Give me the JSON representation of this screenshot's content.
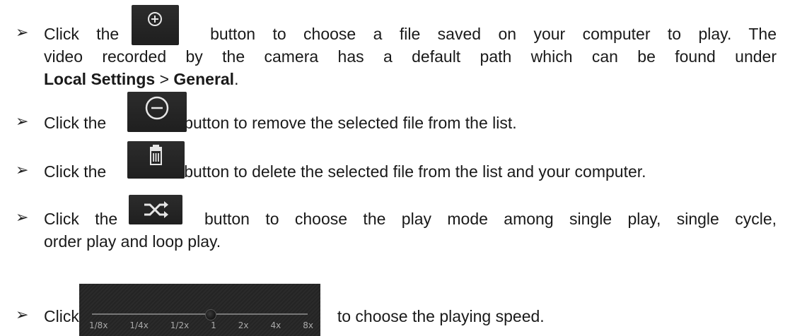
{
  "bullet": "➢",
  "items": [
    {
      "before": "Click the",
      "after": "button to choose a file saved on your computer to play. The",
      "cont": "video recorded by the camera has a default path which can be found under",
      "bold1": "Local Settings",
      "sep": " > ",
      "bold2": "General",
      "end": ".",
      "icon": "add-circle-icon"
    },
    {
      "before": "Click the",
      "after": "button to remove the selected file from the list.",
      "icon": "remove-circle-icon"
    },
    {
      "before": "Click the",
      "after": "button to delete the selected file from the list and your computer.",
      "icon": "trash-icon"
    },
    {
      "before": "Click the",
      "after": "button to choose the play mode among single play, single cycle,",
      "cont": "order play and loop play.",
      "icon": "shuffle-icon"
    },
    {
      "before": "Click",
      "after": "to choose the playing speed.",
      "icon": "speed-slider"
    }
  ],
  "speed_slider": {
    "labels": [
      "1/8x",
      "1/4x",
      "1/2x",
      "1",
      "2x",
      "4x",
      "8x"
    ],
    "selected": "1"
  }
}
